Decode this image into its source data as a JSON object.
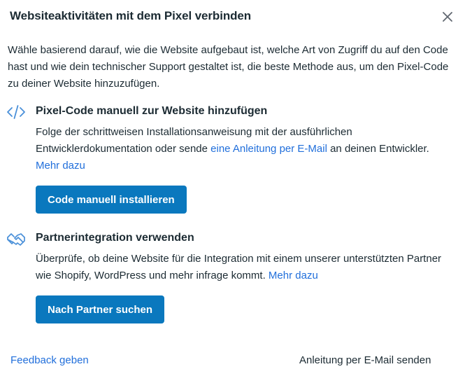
{
  "dialog": {
    "title": "Websiteaktivitäten mit dem Pixel verbinden",
    "close_icon": "close-icon",
    "intro": "Wähle basierend darauf, wie die Website aufgebaut ist, welche Art von Zugriff du auf den Code hast und wie dein technischer Support gestaltet ist, die beste Methode aus, um den Pixel-Code zu deiner Website hinzuzufügen."
  },
  "manual": {
    "icon": "code-icon",
    "title": "Pixel-Code manuell zur Website hinzufügen",
    "desc_part1": "Folge der schrittweisen Installationsanweisung mit der ausführlichen Entwicklerdokumentation oder sende ",
    "email_link": "eine Anleitung per E-Mail",
    "desc_part2": " an deinen Entwickler. ",
    "more_link": "Mehr dazu",
    "button_label": "Code manuell installieren"
  },
  "partner": {
    "icon": "handshake-icon",
    "title": "Partnerintegration verwenden",
    "desc": "Überprüfe, ob deine Website für die Integration mit einem unserer unterstützten Partner wie Shopify, WordPress und mehr infrage kommt. ",
    "more_link": "Mehr dazu",
    "button_label": "Nach Partner suchen"
  },
  "footer": {
    "feedback_label": "Feedback geben",
    "email_instructions_label": "Anleitung per E-Mail senden"
  },
  "colors": {
    "accent": "#0a78be",
    "link": "#216fdb",
    "text": "#1c2b33",
    "icon": "#4a90d9"
  }
}
